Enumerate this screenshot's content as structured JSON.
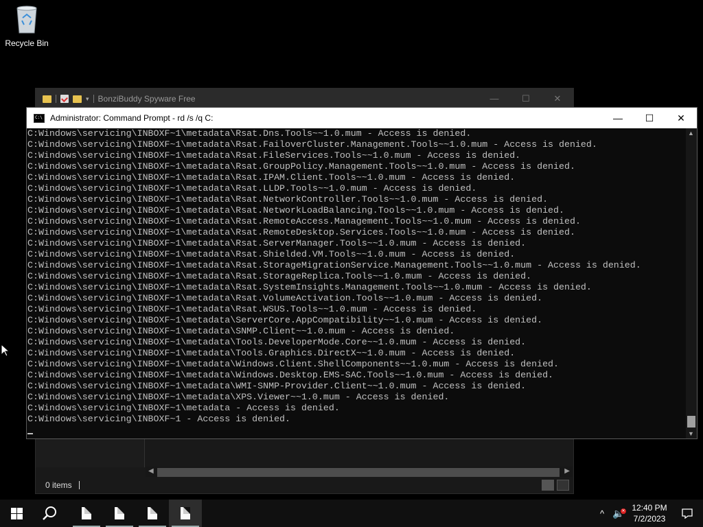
{
  "desktop": {
    "recycle_bin_label": "Recycle Bin"
  },
  "explorer": {
    "title": "BonziBuddy Spyware Free",
    "status_items": "0 items",
    "window_controls": [
      "minimize-icon",
      "maximize-icon",
      "close-icon"
    ]
  },
  "cmd": {
    "title": "Administrator:  Command Prompt - rd  /s /q C:",
    "lines": [
      "C:Windows\\servicing\\INBOXF~1\\metadata\\Rsat.Dns.Tools~~1.0.mum - Access is denied.",
      "C:Windows\\servicing\\INBOXF~1\\metadata\\Rsat.FailoverCluster.Management.Tools~~1.0.mum - Access is denied.",
      "C:Windows\\servicing\\INBOXF~1\\metadata\\Rsat.FileServices.Tools~~1.0.mum - Access is denied.",
      "C:Windows\\servicing\\INBOXF~1\\metadata\\Rsat.GroupPolicy.Management.Tools~~1.0.mum - Access is denied.",
      "C:Windows\\servicing\\INBOXF~1\\metadata\\Rsat.IPAM.Client.Tools~~1.0.mum - Access is denied.",
      "C:Windows\\servicing\\INBOXF~1\\metadata\\Rsat.LLDP.Tools~~1.0.mum - Access is denied.",
      "C:Windows\\servicing\\INBOXF~1\\metadata\\Rsat.NetworkController.Tools~~1.0.mum - Access is denied.",
      "C:Windows\\servicing\\INBOXF~1\\metadata\\Rsat.NetworkLoadBalancing.Tools~~1.0.mum - Access is denied.",
      "C:Windows\\servicing\\INBOXF~1\\metadata\\Rsat.RemoteAccess.Management.Tools~~1.0.mum - Access is denied.",
      "C:Windows\\servicing\\INBOXF~1\\metadata\\Rsat.RemoteDesktop.Services.Tools~~1.0.mum - Access is denied.",
      "C:Windows\\servicing\\INBOXF~1\\metadata\\Rsat.ServerManager.Tools~~1.0.mum - Access is denied.",
      "C:Windows\\servicing\\INBOXF~1\\metadata\\Rsat.Shielded.VM.Tools~~1.0.mum - Access is denied.",
      "C:Windows\\servicing\\INBOXF~1\\metadata\\Rsat.StorageMigrationService.Management.Tools~~1.0.mum - Access is denied.",
      "C:Windows\\servicing\\INBOXF~1\\metadata\\Rsat.StorageReplica.Tools~~1.0.mum - Access is denied.",
      "C:Windows\\servicing\\INBOXF~1\\metadata\\Rsat.SystemInsights.Management.Tools~~1.0.mum - Access is denied.",
      "C:Windows\\servicing\\INBOXF~1\\metadata\\Rsat.VolumeActivation.Tools~~1.0.mum - Access is denied.",
      "C:Windows\\servicing\\INBOXF~1\\metadata\\Rsat.WSUS.Tools~~1.0.mum - Access is denied.",
      "C:Windows\\servicing\\INBOXF~1\\metadata\\ServerCore.AppCompatibility~~1.0.mum - Access is denied.",
      "C:Windows\\servicing\\INBOXF~1\\metadata\\SNMP.Client~~1.0.mum - Access is denied.",
      "C:Windows\\servicing\\INBOXF~1\\metadata\\Tools.DeveloperMode.Core~~1.0.mum - Access is denied.",
      "C:Windows\\servicing\\INBOXF~1\\metadata\\Tools.Graphics.DirectX~~1.0.mum - Access is denied.",
      "C:Windows\\servicing\\INBOXF~1\\metadata\\Windows.Client.ShellComponents~~1.0.mum - Access is denied.",
      "C:Windows\\servicing\\INBOXF~1\\metadata\\Windows.Desktop.EMS-SAC.Tools~~1.0.mum - Access is denied.",
      "C:Windows\\servicing\\INBOXF~1\\metadata\\WMI-SNMP-Provider.Client~~1.0.mum - Access is denied.",
      "C:Windows\\servicing\\INBOXF~1\\metadata\\XPS.Viewer~~1.0.mum - Access is denied.",
      "C:Windows\\servicing\\INBOXF~1\\metadata - Access is denied.",
      "C:Windows\\servicing\\INBOXF~1 - Access is denied."
    ]
  },
  "taskbar": {
    "clock_time": "12:40 PM",
    "clock_date": "7/2/2023",
    "apps": [
      "document-icon",
      "document-icon",
      "document-icon",
      "document-icon"
    ]
  },
  "colors": {
    "console_text": "#c0c0c0",
    "console_bg": "#0c0c0c",
    "taskbar_bg": "#101010"
  }
}
